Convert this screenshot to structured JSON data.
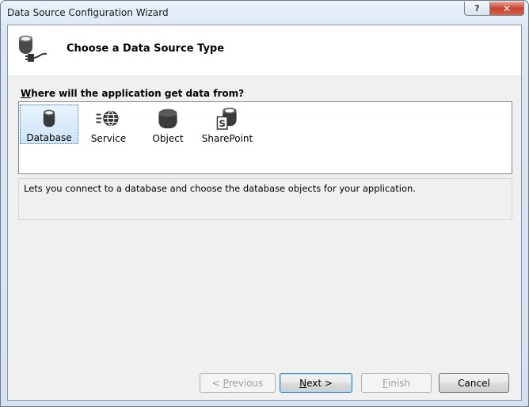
{
  "window": {
    "title": "Data Source Configuration Wizard",
    "help_glyph": "?",
    "close_glyph": "✕"
  },
  "header": {
    "title": "Choose a Data Source Type"
  },
  "question": {
    "mnemonic": "W",
    "rest": "here will the application get data from?"
  },
  "data_sources": [
    {
      "label": "Database",
      "icon": "database-icon",
      "selected": true
    },
    {
      "label": "Service",
      "icon": "service-icon",
      "selected": false
    },
    {
      "label": "Object",
      "icon": "object-icon",
      "selected": false
    },
    {
      "label": "SharePoint",
      "icon": "sharepoint-icon",
      "selected": false
    }
  ],
  "description": "Lets you connect to a database and choose the database objects for your application.",
  "buttons": {
    "previous": {
      "prefix": "< ",
      "mnemonic": "P",
      "rest": "revious",
      "enabled": false
    },
    "next": {
      "mnemonic": "N",
      "rest": "ext >",
      "enabled": true
    },
    "finish": {
      "mnemonic": "F",
      "rest": "inish",
      "enabled": false
    },
    "cancel": {
      "label": "Cancel",
      "enabled": true
    }
  }
}
